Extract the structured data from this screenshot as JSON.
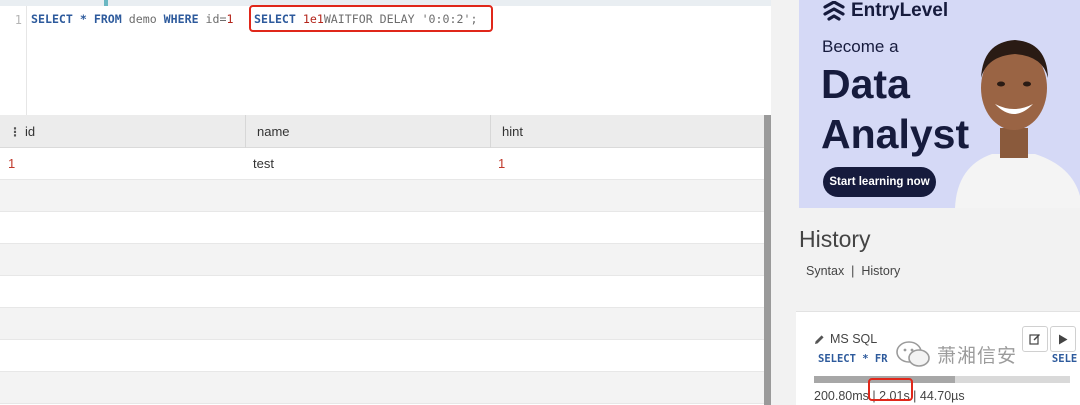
{
  "editor": {
    "line_number": "1",
    "query_part1_kw1": "SELECT",
    "query_part1_star": "*",
    "query_part1_kw2": "FROM",
    "query_part1_table": "demo",
    "query_part1_kw3": "WHERE",
    "query_part1_cond": "id=",
    "query_part1_num": "1",
    "query_part2_kw": "SELECT",
    "query_part2_num": "1e1",
    "query_part2_rest": "WAITFOR DELAY ",
    "query_part2_str": "'0:0:2'",
    "query_part2_end": ";"
  },
  "results": {
    "columns": [
      "id",
      "name",
      "hint"
    ],
    "rows": [
      {
        "id": "1",
        "name": "test",
        "hint": "1"
      }
    ]
  },
  "ad": {
    "brand": "EntryLevel",
    "line1": "Become a",
    "line2": "Data",
    "line3": "Analyst",
    "cta": "Start learning now"
  },
  "history": {
    "title": "History",
    "link_syntax": "Syntax",
    "separator": "|",
    "link_history": "History",
    "card": {
      "db": "MS SQL",
      "query_prefix": "SELECT * FR",
      "query_suffix": "SELE",
      "stat1": "200.80ms",
      "stat2": "2.01s",
      "stat3": "44.70µs",
      "progress": 0.55
    }
  },
  "watermark": {
    "text": "萧湘信安"
  },
  "colors": {
    "keyword": "#2d5a9c",
    "number": "#b3241a",
    "highlight": "#e0271a",
    "ad_bg": "#d5d9f6",
    "ad_text": "#161b3d"
  }
}
